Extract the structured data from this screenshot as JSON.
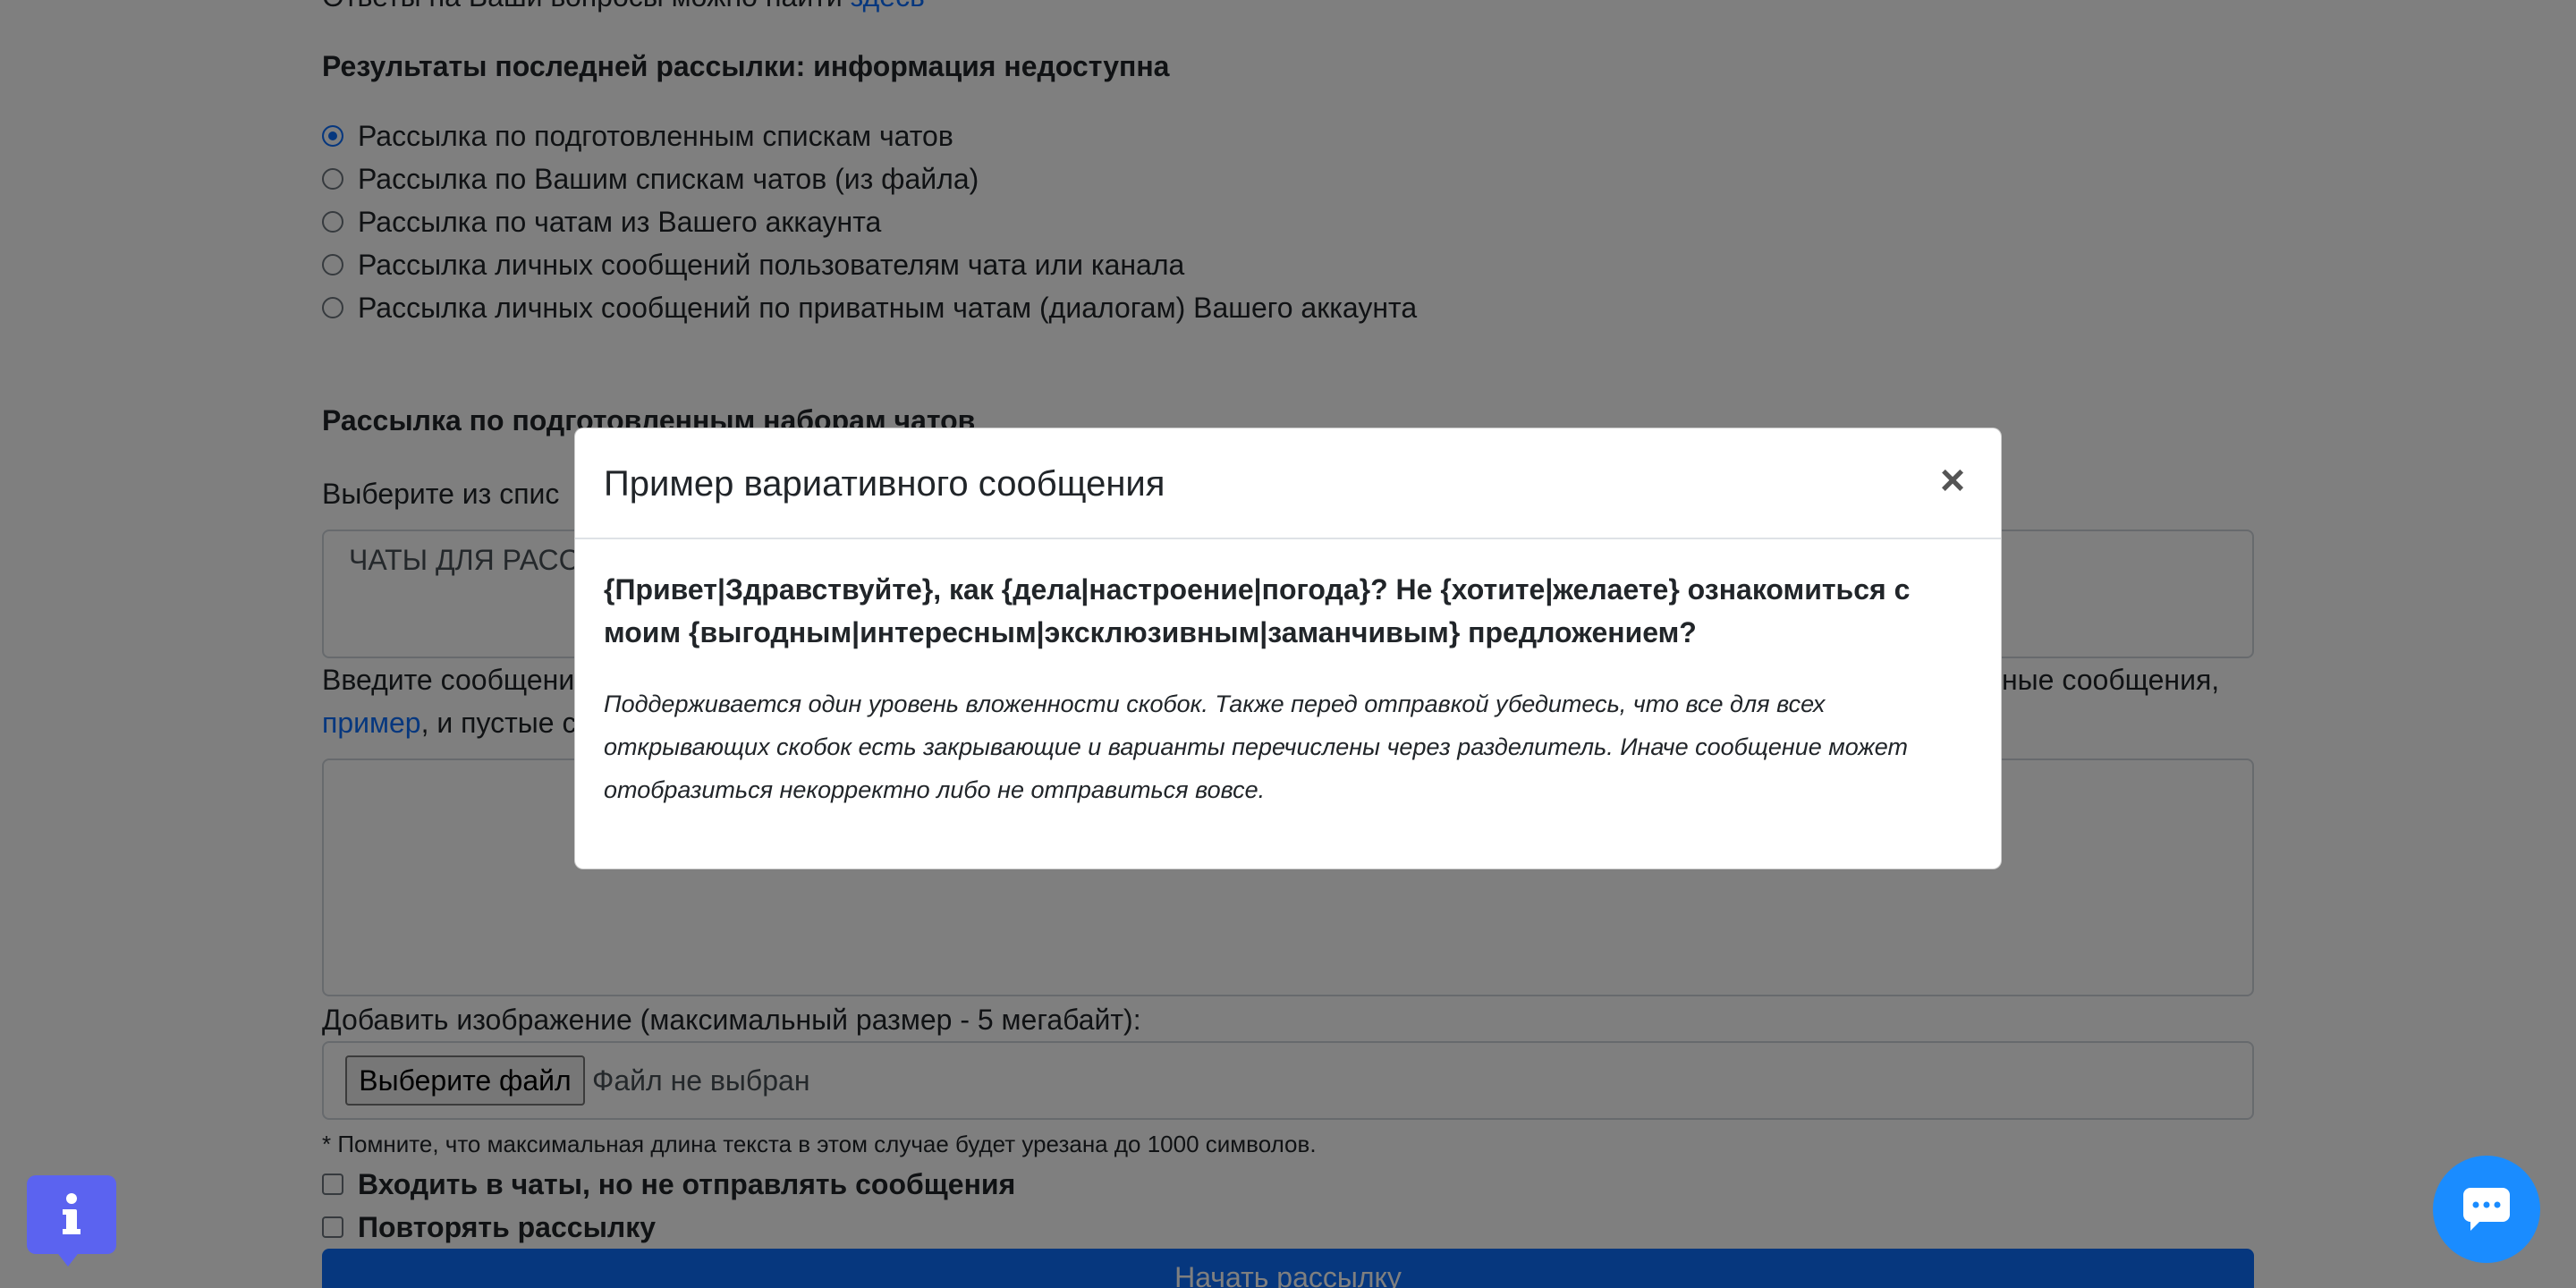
{
  "page": {
    "faq_text": "Ответы на Ваши вопросы можно найти",
    "faq_link": "здесь",
    "results_label": "Результаты последней рассылки:",
    "results_value": "информация недоступна",
    "modes": [
      {
        "label": "Рассылка по подготовленным спискам чатов",
        "checked": true
      },
      {
        "label": "Рассылка по Вашим спискам чатов (из файла)",
        "checked": false
      },
      {
        "label": "Рассылка по чатам из Вашего аккаунта",
        "checked": false
      },
      {
        "label": "Рассылка личных сообщений пользователям чата или канала",
        "checked": false
      },
      {
        "label": "Рассылка личных сообщений по приватным чатам (диалогам) Вашего аккаунта",
        "checked": false
      }
    ],
    "section_title": "Рассылка по подготовленным наборам чатов",
    "choose_list_label": "Выберите из спис",
    "chat_list_value": "ЧАТЫ ДЛЯ РАСС",
    "message_label_start": "Введите сообщени",
    "message_label_end": "ные сообщения,",
    "example_link": "пример",
    "message_label_cont": ", и пустые с",
    "image_label": "Добавить изображение (максимальный размер - 5 мегабайт):",
    "file_button": "Выберите файл",
    "file_status": "Файл не выбран",
    "length_note": "* Помните, что максимальная длина текста в этом случае будет урезана до 1000 символов.",
    "join_only": "Входить в чаты, но не отправлять сообщения",
    "repeat": "Повторять рассылку",
    "start_button": "Начать рассылку"
  },
  "modal": {
    "title": "Пример вариативного сообщения",
    "close": "×",
    "example": "{Привет|Здравствуйте}, как {дела|настроение|погода}? Не {хотите|желаете} ознакомиться с моим {выгодным|интересным|эксклюзивным|заманчивым} предложением?",
    "note": "Поддерживается один уровень вложенности скобок. Также перед отправкой убедитесь, что все для всех открывающих скобок есть закрывающие и варианты перечислены через разделитель. Иначе сообщение может отобразиться некорректно либо не отправиться вовсе."
  },
  "widgets": {
    "info_icon": "info-icon",
    "chat_icon": "chat-bubble-icon",
    "info_color": "#5b63f0",
    "chat_color": "#1a8cff"
  }
}
